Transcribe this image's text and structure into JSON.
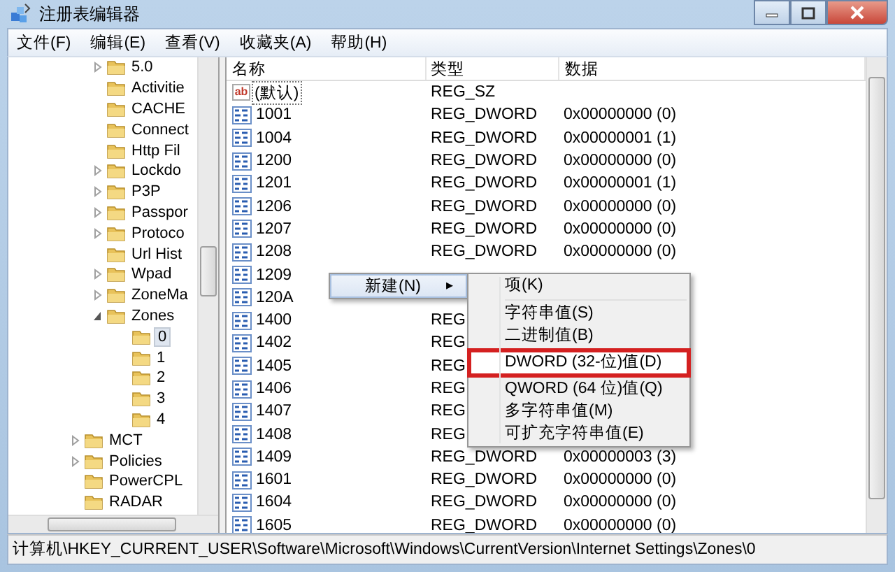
{
  "window": {
    "title": "注册表编辑器"
  },
  "menu_bar": [
    "文件(F)",
    "编辑(E)",
    "查看(V)",
    "收藏夹(A)",
    "帮助(H)"
  ],
  "tree": [
    {
      "label": "5.0",
      "expanded": false
    },
    {
      "label": "Activitie"
    },
    {
      "label": "CACHE"
    },
    {
      "label": "Connect"
    },
    {
      "label": "Http Fil"
    },
    {
      "label": "Lockdo",
      "expanded": false
    },
    {
      "label": "P3P",
      "expanded": false
    },
    {
      "label": "Passpor",
      "expanded": false
    },
    {
      "label": "Protoco",
      "expanded": false
    },
    {
      "label": "Url Hist"
    },
    {
      "label": "Wpad",
      "expanded": false
    },
    {
      "label": "ZoneMa",
      "expanded": false
    },
    {
      "label": "Zones",
      "expanded": true,
      "children": [
        {
          "label": "0",
          "selected": true
        },
        {
          "label": "1",
          "selected": false
        },
        {
          "label": "2",
          "selected": false
        },
        {
          "label": "3",
          "selected": false
        },
        {
          "label": "4",
          "selected": false
        }
      ]
    }
  ],
  "tree_after": [
    {
      "label": "MCT",
      "expanded": false
    },
    {
      "label": "Policies",
      "expanded": false
    },
    {
      "label": "PowerCPL"
    },
    {
      "label": "RADAR"
    }
  ],
  "table": {
    "columns": [
      "名称",
      "类型",
      "数据"
    ],
    "rows": [
      {
        "kind": "string",
        "icon_label": "ab",
        "name": "(默认)",
        "type": "REG_SZ",
        "focused": true
      },
      {
        "kind": "binary",
        "name": "1001",
        "type": "REG_DWORD",
        "data": "0x00000000 (0)",
        "focused": false
      },
      {
        "kind": "binary",
        "name": "1004",
        "type": "REG_DWORD",
        "data": "0x00000001 (1)",
        "focused": false
      },
      {
        "kind": "binary",
        "name": "1200",
        "type": "REG_DWORD",
        "data": "0x00000000 (0)",
        "focused": false
      },
      {
        "kind": "binary",
        "name": "1201",
        "type": "REG_DWORD",
        "data": "0x00000001 (1)",
        "focused": false
      },
      {
        "kind": "binary",
        "name": "1206",
        "type": "REG_DWORD",
        "data": "0x00000000 (0)",
        "focused": false
      },
      {
        "kind": "binary",
        "name": "1207",
        "type": "REG_DWORD",
        "data": "0x00000000 (0)",
        "focused": false
      },
      {
        "kind": "binary",
        "name": "1208",
        "type": "REG_DWORD",
        "data": "0x00000000 (0)",
        "focused": false
      },
      {
        "kind": "binary",
        "name": "1209",
        "focused": false
      },
      {
        "kind": "binary",
        "name": "120A",
        "focused": false
      },
      {
        "kind": "binary",
        "name": "1400",
        "type": "REG",
        "focused": false
      },
      {
        "kind": "binary",
        "name": "1402",
        "type": "REG",
        "focused": false
      },
      {
        "kind": "binary",
        "name": "1405",
        "type": "REG",
        "focused": false
      },
      {
        "kind": "binary",
        "name": "1406",
        "type": "REG",
        "focused": false
      },
      {
        "kind": "binary",
        "name": "1407",
        "type": "REG",
        "focused": false
      },
      {
        "kind": "binary",
        "name": "1408",
        "type": "REG",
        "focused": false
      },
      {
        "kind": "binary",
        "name": "1409",
        "type": "REG_DWORD",
        "data": "0x00000003 (3)",
        "focused": false
      },
      {
        "kind": "binary",
        "name": "1601",
        "type": "REG_DWORD",
        "data": "0x00000000 (0)",
        "focused": false
      },
      {
        "kind": "binary",
        "name": "1604",
        "type": "REG_DWORD",
        "data": "0x00000000 (0)",
        "focused": false
      },
      {
        "kind": "binary",
        "name": "1605",
        "type": "REG_DWORD",
        "data": "0x00000000 (0)",
        "focused": false
      }
    ]
  },
  "context_menu": {
    "label": "新建(N)",
    "arrow": "▸",
    "submenu": [
      {
        "kind": "item",
        "label": "项(K)",
        "highlighted": false
      },
      {
        "kind": "separator"
      },
      {
        "kind": "item",
        "label": "字符串值(S)",
        "highlighted": false
      },
      {
        "kind": "item",
        "label": "二进制值(B)",
        "highlighted": false
      },
      {
        "kind": "item",
        "label": "DWORD (32-位)值(D)",
        "highlighted": true
      },
      {
        "kind": "item",
        "label": "QWORD (64 位)值(Q)",
        "highlighted": false
      },
      {
        "kind": "item",
        "label": "多字符串值(M)",
        "highlighted": false
      },
      {
        "kind": "item",
        "label": "可扩充字符串值(E)",
        "highlighted": false
      }
    ]
  },
  "status_bar": "计算机\\HKEY_CURRENT_USER\\Software\\Microsoft\\Windows\\CurrentVersion\\Internet Settings\\Zones\\0"
}
